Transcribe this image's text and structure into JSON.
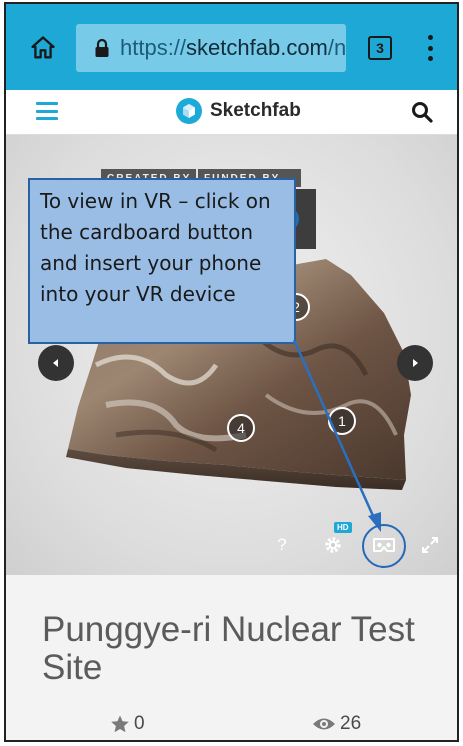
{
  "browser": {
    "url_host": "sketchfab.com",
    "url_prefix": "https://",
    "url_suffix": "/n",
    "tab_count": "3",
    "colors": {
      "toolbar": "#1ea8d6",
      "urlbox": "#78cbe8"
    }
  },
  "site": {
    "brand": "Sketchfab",
    "accent": "#1ea8d6"
  },
  "viewer": {
    "credit_created": "CREATED BY",
    "credit_funded": "FUNDED BY",
    "annotations": [
      "2",
      "4",
      "1"
    ],
    "help_label": "?",
    "hd_badge": "HD"
  },
  "callout": {
    "text": "To view in VR – click on the cardboard button and insert your phone into your VR device",
    "fill": "#99bde5",
    "border": "#2a61a5"
  },
  "model": {
    "title": "Punggye-ri Nuclear Test Site",
    "likes": "0",
    "views": "26"
  }
}
